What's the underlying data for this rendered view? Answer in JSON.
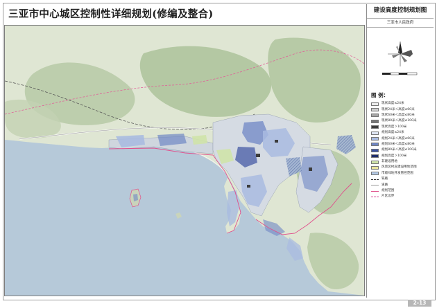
{
  "title": "三亚市中心城区控制性详细规划(修编及整合)",
  "panel": {
    "title": "建设高度控制规划图",
    "subtitle": "三亚市人民政府"
  },
  "legend": {
    "title": "图 例：",
    "items": [
      {
        "label": "现状高度≤24米",
        "color": "#ececec",
        "style": "fill"
      },
      {
        "label": "现状24米＜高度≤60米",
        "color": "#cfcfcf",
        "style": "fill"
      },
      {
        "label": "现状60米＜高度≤80米",
        "color": "#a5a5a5",
        "style": "fill"
      },
      {
        "label": "现状80米＜高度≤100米",
        "color": "#767676",
        "style": "fill"
      },
      {
        "label": "现状高度＞100米",
        "color": "#3c3c3c",
        "style": "fill"
      },
      {
        "label": "规划高度≤24米",
        "color": "#dfe6f4",
        "style": "fill"
      },
      {
        "label": "规划24米＜高度≤60米",
        "color": "#a9bbe0",
        "style": "fill"
      },
      {
        "label": "规划60米＜高度≤80米",
        "color": "#6f87c5",
        "style": "fill"
      },
      {
        "label": "规划80米＜高度≤100米",
        "color": "#3c53a1",
        "style": "fill"
      },
      {
        "label": "规划高度＞100米",
        "color": "#1e2c6b",
        "style": "fill"
      },
      {
        "label": "非建设用地",
        "color": "#cfe3a9",
        "style": "fill"
      },
      {
        "label": "风景区村庄建设用地范围",
        "color": "#e8e39c",
        "style": "fill"
      },
      {
        "label": "市级绿地开发管控范围",
        "color": "#b4cbe8",
        "style": "fill"
      },
      {
        "label": "铁路",
        "color": "#333333",
        "style": "dash"
      },
      {
        "label": "道路",
        "color": "#999999",
        "style": "line"
      },
      {
        "label": "规划范围",
        "color": "#e0508c",
        "style": "line"
      },
      {
        "label": "片区边界",
        "color": "#d24090",
        "style": "dash"
      }
    ]
  },
  "page_number": "2-13",
  "colors": {
    "sea": "#b6c9d9",
    "land": "#dfe6d3",
    "forest": "#b7c9a6",
    "urban_light": "#cfd6de",
    "boundary": "#e0508c",
    "road": "#f2f2f2"
  }
}
